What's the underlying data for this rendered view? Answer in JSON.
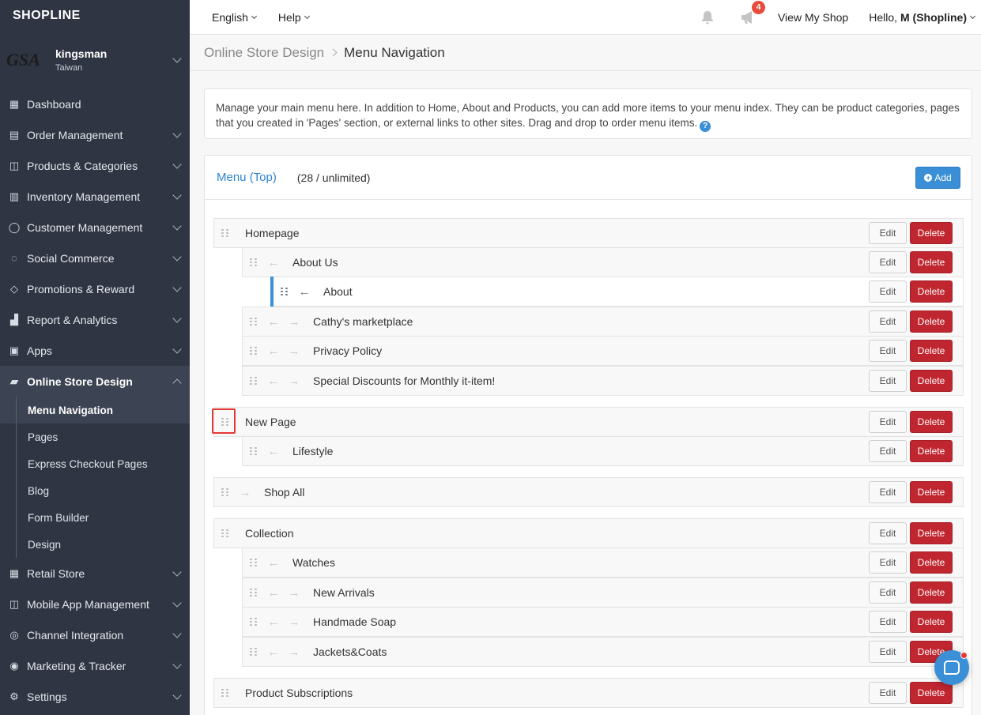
{
  "brand": "SHOPLINE",
  "store": {
    "logo_text": "GSA",
    "name": "kingsman",
    "region": "Taiwan"
  },
  "nav": [
    {
      "id": "dashboard",
      "label": "Dashboard",
      "icon": "dashboard-icon",
      "glyph": "▦"
    },
    {
      "id": "order-management",
      "label": "Order Management",
      "icon": "document-icon",
      "glyph": "▤"
    },
    {
      "id": "products-categories",
      "label": "Products & Categories",
      "icon": "bag-icon",
      "glyph": "◫"
    },
    {
      "id": "inventory-management",
      "label": "Inventory Management",
      "icon": "boxes-icon",
      "glyph": "▥"
    },
    {
      "id": "customer-management",
      "label": "Customer Management",
      "icon": "person-icon",
      "glyph": "◯"
    },
    {
      "id": "social-commerce",
      "label": "Social Commerce",
      "icon": "chat-icon",
      "glyph": "◌"
    },
    {
      "id": "promotions-reward",
      "label": "Promotions & Reward",
      "icon": "tag-icon",
      "glyph": "◇"
    },
    {
      "id": "report-analytics",
      "label": "Report & Analytics",
      "icon": "chart-icon",
      "glyph": "▟"
    },
    {
      "id": "apps",
      "label": "Apps",
      "icon": "apps-icon",
      "glyph": "▣"
    },
    {
      "id": "online-store-design",
      "label": "Online Store Design",
      "icon": "paint-roller-icon",
      "glyph": "▰"
    }
  ],
  "sub_nav": [
    "Menu Navigation",
    "Pages",
    "Express Checkout Pages",
    "Blog",
    "Form Builder",
    "Design"
  ],
  "nav_after": [
    {
      "id": "retail-store",
      "label": "Retail Store",
      "icon": "store-icon",
      "glyph": "▦"
    },
    {
      "id": "mobile-app-management",
      "label": "Mobile App Management",
      "icon": "mobile-bag-icon",
      "glyph": "◫"
    },
    {
      "id": "channel-integration",
      "label": "Channel Integration",
      "icon": "channel-icon",
      "glyph": "◎"
    },
    {
      "id": "marketing-tracker",
      "label": "Marketing & Tracker",
      "icon": "target-icon",
      "glyph": "◉"
    },
    {
      "id": "settings",
      "label": "Settings",
      "icon": "gear-icon",
      "glyph": "⚙"
    }
  ],
  "topbar": {
    "language": "English",
    "help": "Help",
    "notification_count": "4",
    "view_shop": "View My Shop",
    "hello_prefix": "Hello,",
    "user_name": "M (Shopline)"
  },
  "breadcrumb": {
    "parent": "Online Store Design",
    "current": "Menu Navigation"
  },
  "info_text": "Manage your main menu here. In addition to Home, About and Products, you can add more items to your menu index. They can be product categories, pages that you created in 'Pages' section, or external links to other sites. Drag and drop to order menu items.",
  "panel": {
    "title": "Menu (Top)",
    "count": "(28 / unlimited)",
    "add_label": "Add"
  },
  "actions": {
    "edit": "Edit",
    "delete": "Delete"
  },
  "menu_rows": [
    {
      "label": "Homepage",
      "level": 0,
      "arrows": []
    },
    {
      "label": "About Us",
      "level": 1,
      "arrows": [
        "left"
      ]
    },
    {
      "label": "About",
      "level": 2,
      "arrows": [
        "left"
      ],
      "selected": true
    },
    {
      "label": "Cathy's marketplace",
      "level": 1,
      "arrows": [
        "left",
        "right"
      ]
    },
    {
      "label": "Privacy Policy",
      "level": 1,
      "arrows": [
        "left",
        "right"
      ]
    },
    {
      "label": "Special Discounts for Monthly it-item!",
      "level": 1,
      "arrows": [
        "left",
        "right"
      ]
    },
    {
      "label": "New Page",
      "level": 0,
      "arrows": []
    },
    {
      "label": "Lifestyle",
      "level": 1,
      "arrows": [
        "left"
      ]
    },
    {
      "label": "Shop All",
      "level": 0,
      "arrows": [
        "right"
      ]
    },
    {
      "label": "Collection",
      "level": 0,
      "arrows": []
    },
    {
      "label": "Watches",
      "level": 1,
      "arrows": [
        "left"
      ]
    },
    {
      "label": "New Arrivals",
      "level": 1,
      "arrows": [
        "left",
        "right"
      ]
    },
    {
      "label": "Handmade Soap",
      "level": 1,
      "arrows": [
        "left",
        "right"
      ]
    },
    {
      "label": "Jackets&Coats",
      "level": 1,
      "arrows": [
        "left",
        "right"
      ]
    },
    {
      "label": "Product Subscriptions",
      "level": 0,
      "arrows": []
    }
  ]
}
